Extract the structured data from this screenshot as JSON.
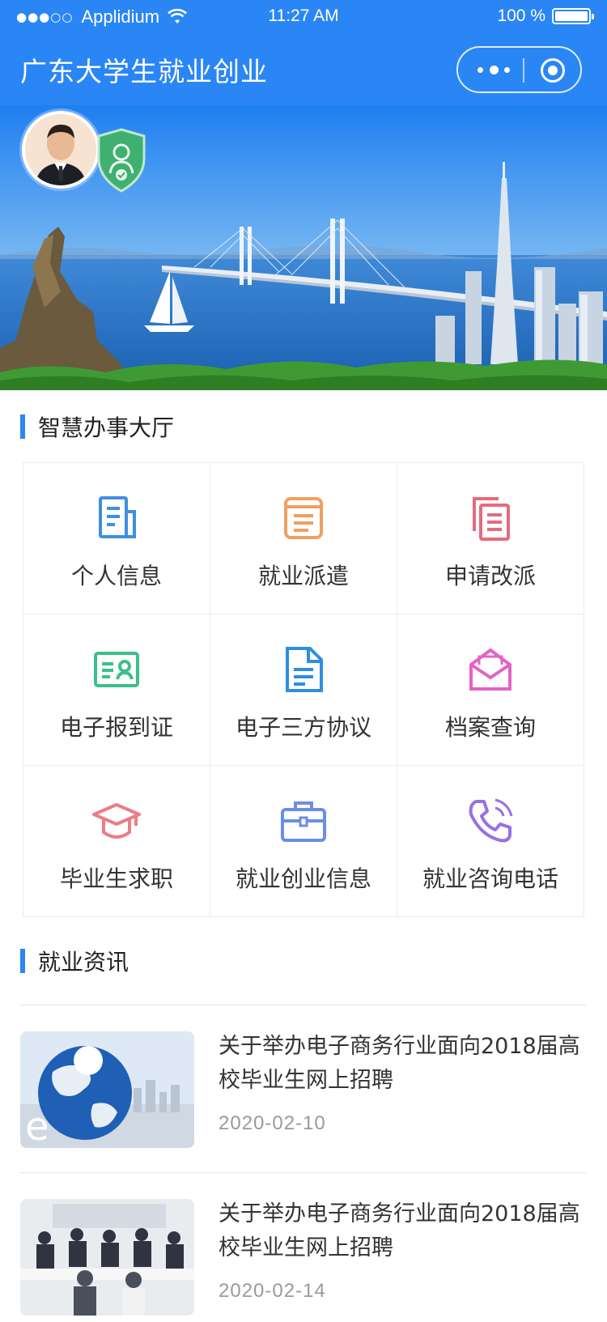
{
  "status_bar": {
    "carrier": "Applidium",
    "time": "11:27 AM",
    "battery": "100 %"
  },
  "nav": {
    "title": "广东大学生就业创业"
  },
  "services": {
    "title": "智慧办事大厅",
    "items": [
      {
        "label": "个人信息",
        "icon": "document-icon",
        "color": "#3f8fe0"
      },
      {
        "label": "就业派遣",
        "icon": "notepad-icon",
        "color": "#f0a060"
      },
      {
        "label": "申请改派",
        "icon": "copy-documents-icon",
        "color": "#e56b7e"
      },
      {
        "label": "电子报到证",
        "icon": "id-card-icon",
        "color": "#3cbf8a"
      },
      {
        "label": "电子三方协议",
        "icon": "contract-icon",
        "color": "#2f8ee0"
      },
      {
        "label": "档案查询",
        "icon": "envelope-icon",
        "color": "#e462c6"
      },
      {
        "label": "毕业生求职",
        "icon": "graduation-cap-icon",
        "color": "#ee7b88"
      },
      {
        "label": "就业创业信息",
        "icon": "briefcase-icon",
        "color": "#6a8ee8"
      },
      {
        "label": "就业咨询电话",
        "icon": "phone-icon",
        "color": "#9b6fe0"
      }
    ]
  },
  "news": {
    "title": "就业资讯",
    "items": [
      {
        "title": "关于举办电子商务行业面向2018届高校毕业生网上招聘",
        "date": "2020-02-10",
        "thumb": "globe-thumbnail"
      },
      {
        "title": "关于举办电子商务行业面向2018届高校毕业生网上招聘",
        "date": "2020-02-14",
        "thumb": "meeting-thumbnail"
      }
    ]
  }
}
